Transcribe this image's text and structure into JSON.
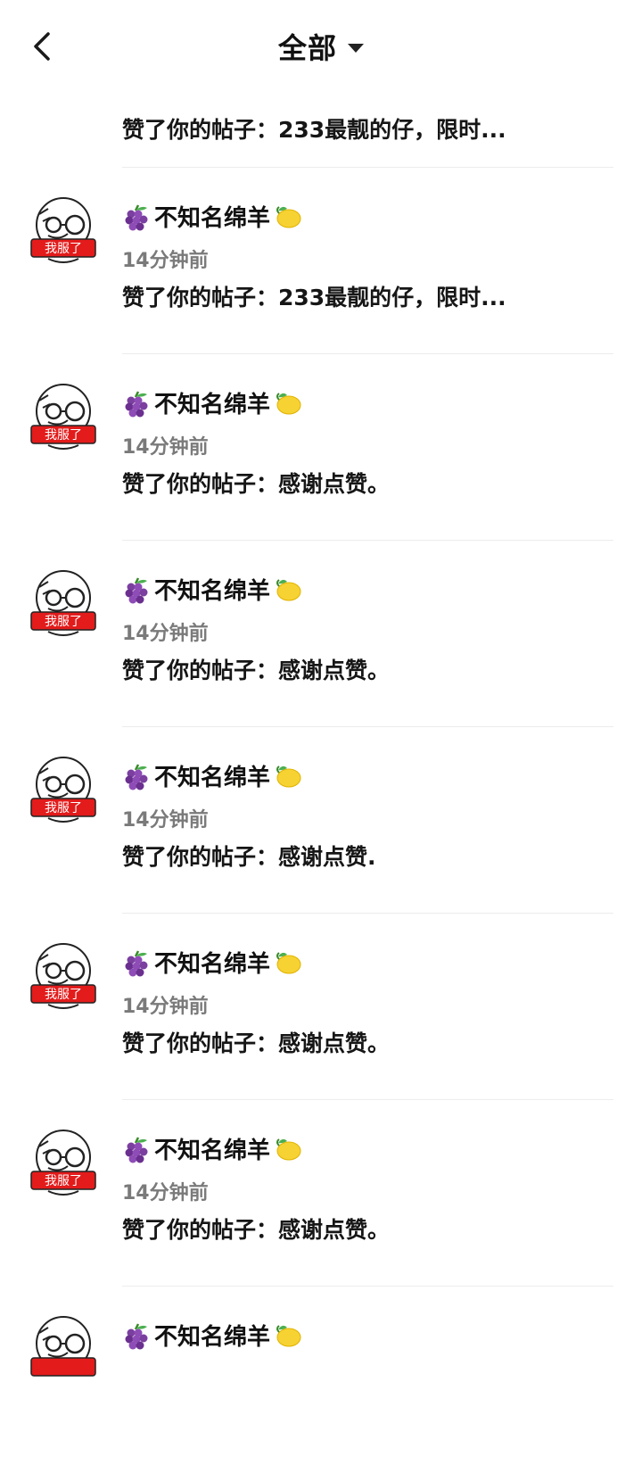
{
  "header": {
    "title": "全部"
  },
  "notifications": [
    {
      "content": "赞了你的帖子：233最靓的仔，限时..."
    },
    {
      "user": "不知名绵羊",
      "time": "14分钟前",
      "content": "赞了你的帖子：233最靓的仔，限时..."
    },
    {
      "user": "不知名绵羊",
      "time": "14分钟前",
      "content": "赞了你的帖子：感谢点赞。"
    },
    {
      "user": "不知名绵羊",
      "time": "14分钟前",
      "content": "赞了你的帖子：感谢点赞。"
    },
    {
      "user": "不知名绵羊",
      "time": "14分钟前",
      "content": "赞了你的帖子：感谢点赞."
    },
    {
      "user": "不知名绵羊",
      "time": "14分钟前",
      "content": "赞了你的帖子：感谢点赞。"
    },
    {
      "user": "不知名绵羊",
      "time": "14分钟前",
      "content": "赞了你的帖子：感谢点赞。"
    },
    {
      "user": "不知名绵羊"
    }
  ],
  "avatar": {
    "badge_text": "我服了",
    "badge_color": "#e31b1b"
  },
  "icons": {
    "back": "back-arrow-icon",
    "dropdown": "caret-down-icon",
    "name_prefix": "grapes-emoji-icon",
    "name_suffix": "lemon-emoji-icon"
  }
}
